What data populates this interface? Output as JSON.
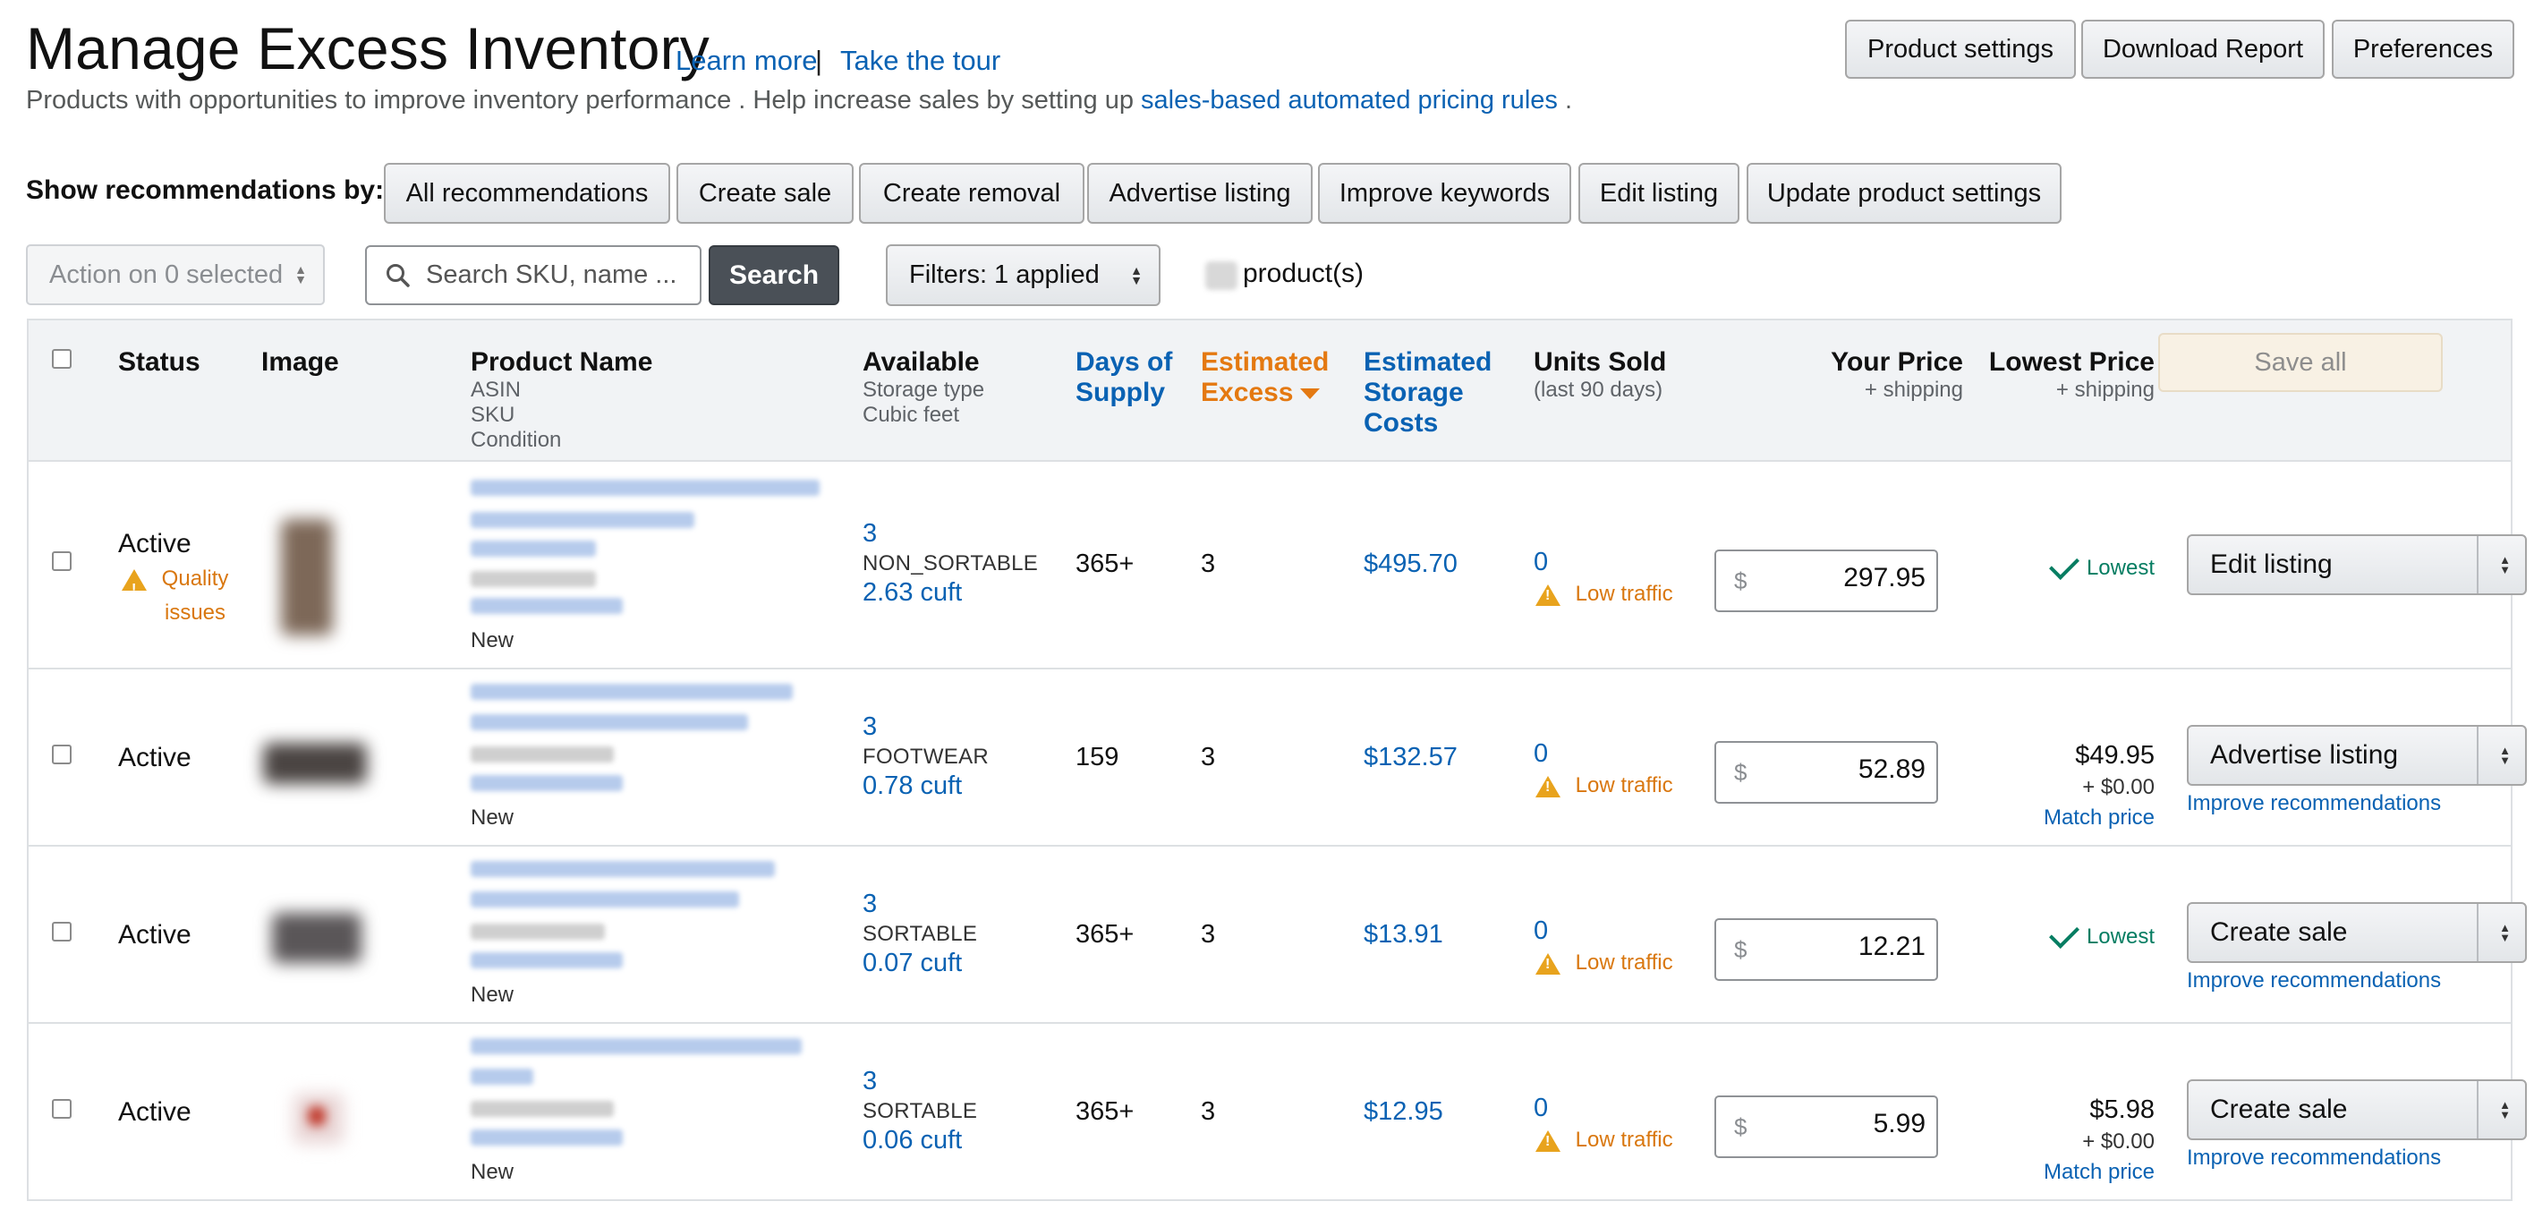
{
  "header": {
    "title": "Manage Excess Inventory",
    "learn_more": "Learn more",
    "separator": "|",
    "take_tour": "Take the tour",
    "subtitle_text": "Products with opportunities to improve inventory performance . Help increase sales by setting up",
    "subtitle_link": "sales-based automated pricing rules",
    "subtitle_end": ".",
    "buttons": {
      "product_settings": "Product settings",
      "download_report": "Download Report",
      "preferences": "Preferences"
    }
  },
  "recommendations": {
    "label": "Show recommendations by:",
    "options": [
      "All recommendations",
      "Create sale",
      "Create removal",
      "Advertise listing",
      "Improve keywords",
      "Edit listing",
      "Update product settings"
    ]
  },
  "toolbar": {
    "action_label": "Action on 0 selected",
    "search_placeholder": "Search SKU, name ...",
    "search_button": "Search",
    "filters_label": "Filters: 1 applied",
    "product_count_label": "product(s)"
  },
  "table": {
    "headers": {
      "status": "Status",
      "image": "Image",
      "product_name": "Product Name",
      "product_sub1": "ASIN",
      "product_sub2": "SKU",
      "product_sub3": "Condition",
      "available": "Available",
      "available_sub1": "Storage type",
      "available_sub2": "Cubic feet",
      "days_line1": "Days of",
      "days_line2": "Supply",
      "excess_line1": "Estimated",
      "excess_line2": "Excess",
      "storage_line1": "Estimated",
      "storage_line2": "Storage",
      "storage_line3": "Costs",
      "units_sold": "Units Sold",
      "units_sold_sub": "(last 90 days)",
      "your_price": "Your Price",
      "your_price_sub": "+ shipping",
      "lowest_price": "Lowest Price",
      "lowest_price_sub": "+ shipping",
      "save_all": "Save all"
    },
    "currency_symbol": "$",
    "low_traffic_label": "Low traffic",
    "lowest_label": "Lowest",
    "match_price_label": "Match price",
    "improve_label": "Improve recommendations",
    "rows": [
      {
        "status": "Active",
        "quality_line1": "Quality",
        "quality_line2": "issues",
        "condition": "New",
        "available": "3",
        "storage_type": "NON_SORTABLE",
        "cubic_feet": "2.63 cuft",
        "days_of_supply": "365+",
        "excess": "3",
        "storage_cost": "$495.70",
        "units_sold": "0",
        "your_price": "297.95",
        "action": "Edit listing"
      },
      {
        "status": "Active",
        "condition": "New",
        "available": "3",
        "storage_type": "FOOTWEAR",
        "cubic_feet": "0.78 cuft",
        "days_of_supply": "159",
        "excess": "3",
        "storage_cost": "$132.57",
        "units_sold": "0",
        "your_price": "52.89",
        "lowest_price": "$49.95",
        "lowest_shipping": "+ $0.00",
        "action": "Advertise listing"
      },
      {
        "status": "Active",
        "condition": "New",
        "available": "3",
        "storage_type": "SORTABLE",
        "cubic_feet": "0.07 cuft",
        "days_of_supply": "365+",
        "excess": "3",
        "storage_cost": "$13.91",
        "units_sold": "0",
        "your_price": "12.21",
        "action": "Create sale"
      },
      {
        "status": "Active",
        "condition": "New",
        "available": "3",
        "storage_type": "SORTABLE",
        "cubic_feet": "0.06 cuft",
        "days_of_supply": "365+",
        "excess": "3",
        "storage_cost": "$12.95",
        "units_sold": "0",
        "your_price": "5.99",
        "lowest_price": "$5.98",
        "lowest_shipping": "+ $0.00",
        "action": "Create sale"
      }
    ]
  },
  "colors": {
    "link_blue": "#0a62b3",
    "sort_orange": "#e47911",
    "warning_orange": "#d9770f",
    "lowest_green": "#067d62",
    "search_button": "#4a5057"
  }
}
